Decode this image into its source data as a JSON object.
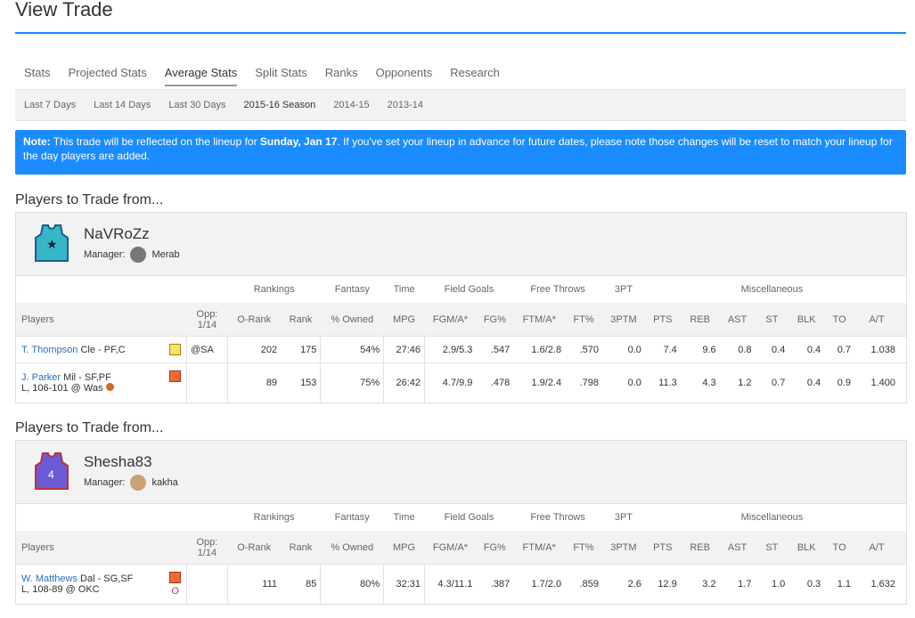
{
  "title": "View Trade",
  "tabs": [
    "Stats",
    "Projected Stats",
    "Average Stats",
    "Split Stats",
    "Ranks",
    "Opponents",
    "Research"
  ],
  "subtabs": [
    "Last 7 Days",
    "Last 14 Days",
    "Last 30 Days",
    "2015-16 Season",
    "2014-15",
    "2013-14"
  ],
  "note": {
    "label": "Note:",
    "text1": " This trade will be reflected on the lineup for ",
    "date": "Sunday, Jan 17",
    "text2": ". If you've set your lineup in advance for future dates, please note those changes will be reset to match your lineup for the day players are added."
  },
  "groups": [
    "Rankings",
    "Fantasy",
    "Time",
    "Field Goals",
    "Free Throws",
    "3PT",
    "Miscellaneous"
  ],
  "columns": [
    "Players",
    "Opp: 1/14",
    "O-Rank",
    "Rank",
    "% Owned",
    "MPG",
    "FGM/A*",
    "FG%",
    "FTM/A*",
    "FT%",
    "3PTM",
    "PTS",
    "REB",
    "AST",
    "ST",
    "BLK",
    "TO",
    "A/T"
  ],
  "teams": [
    {
      "section": "Players to Trade from...",
      "name": "NaVRoZz",
      "manager_label": "Manager:",
      "manager": "Merab",
      "players": [
        {
          "name": "T. Thompson",
          "info": "Cle - PF,C",
          "game": "",
          "opp": "@SA",
          "stats": [
            "202",
            "175",
            "54%",
            "27:46",
            "2.9/5.3",
            ".547",
            "1.6/2.8",
            ".570",
            "0.0",
            "7.4",
            "9.6",
            "0.8",
            "0.4",
            "0.4",
            "0.7",
            "1.038"
          ]
        },
        {
          "name": "J. Parker",
          "info": "Mil - SF,PF",
          "game": "L, 106-101 @ Was",
          "opp": "",
          "stats": [
            "89",
            "153",
            "75%",
            "26:42",
            "4.7/9.9",
            ".478",
            "1.9/2.4",
            ".798",
            "0.0",
            "11.3",
            "4.3",
            "1.2",
            "0.7",
            "0.4",
            "0.9",
            "1.400"
          ]
        }
      ]
    },
    {
      "section": "Players to Trade from...",
      "name": "Shesha83",
      "manager_label": "Manager:",
      "manager": "kakha",
      "players": [
        {
          "name": "W. Matthews",
          "info": "Dal - SG,SF",
          "game": "L, 108-89 @ OKC",
          "opp": "",
          "status": "O",
          "stats": [
            "111",
            "85",
            "80%",
            "32:31",
            "4.3/11.1",
            ".387",
            "1.7/2.0",
            ".859",
            "2.6",
            "12.9",
            "3.2",
            "1.7",
            "1.0",
            "0.3",
            "1.1",
            "1.632"
          ]
        }
      ]
    }
  ]
}
